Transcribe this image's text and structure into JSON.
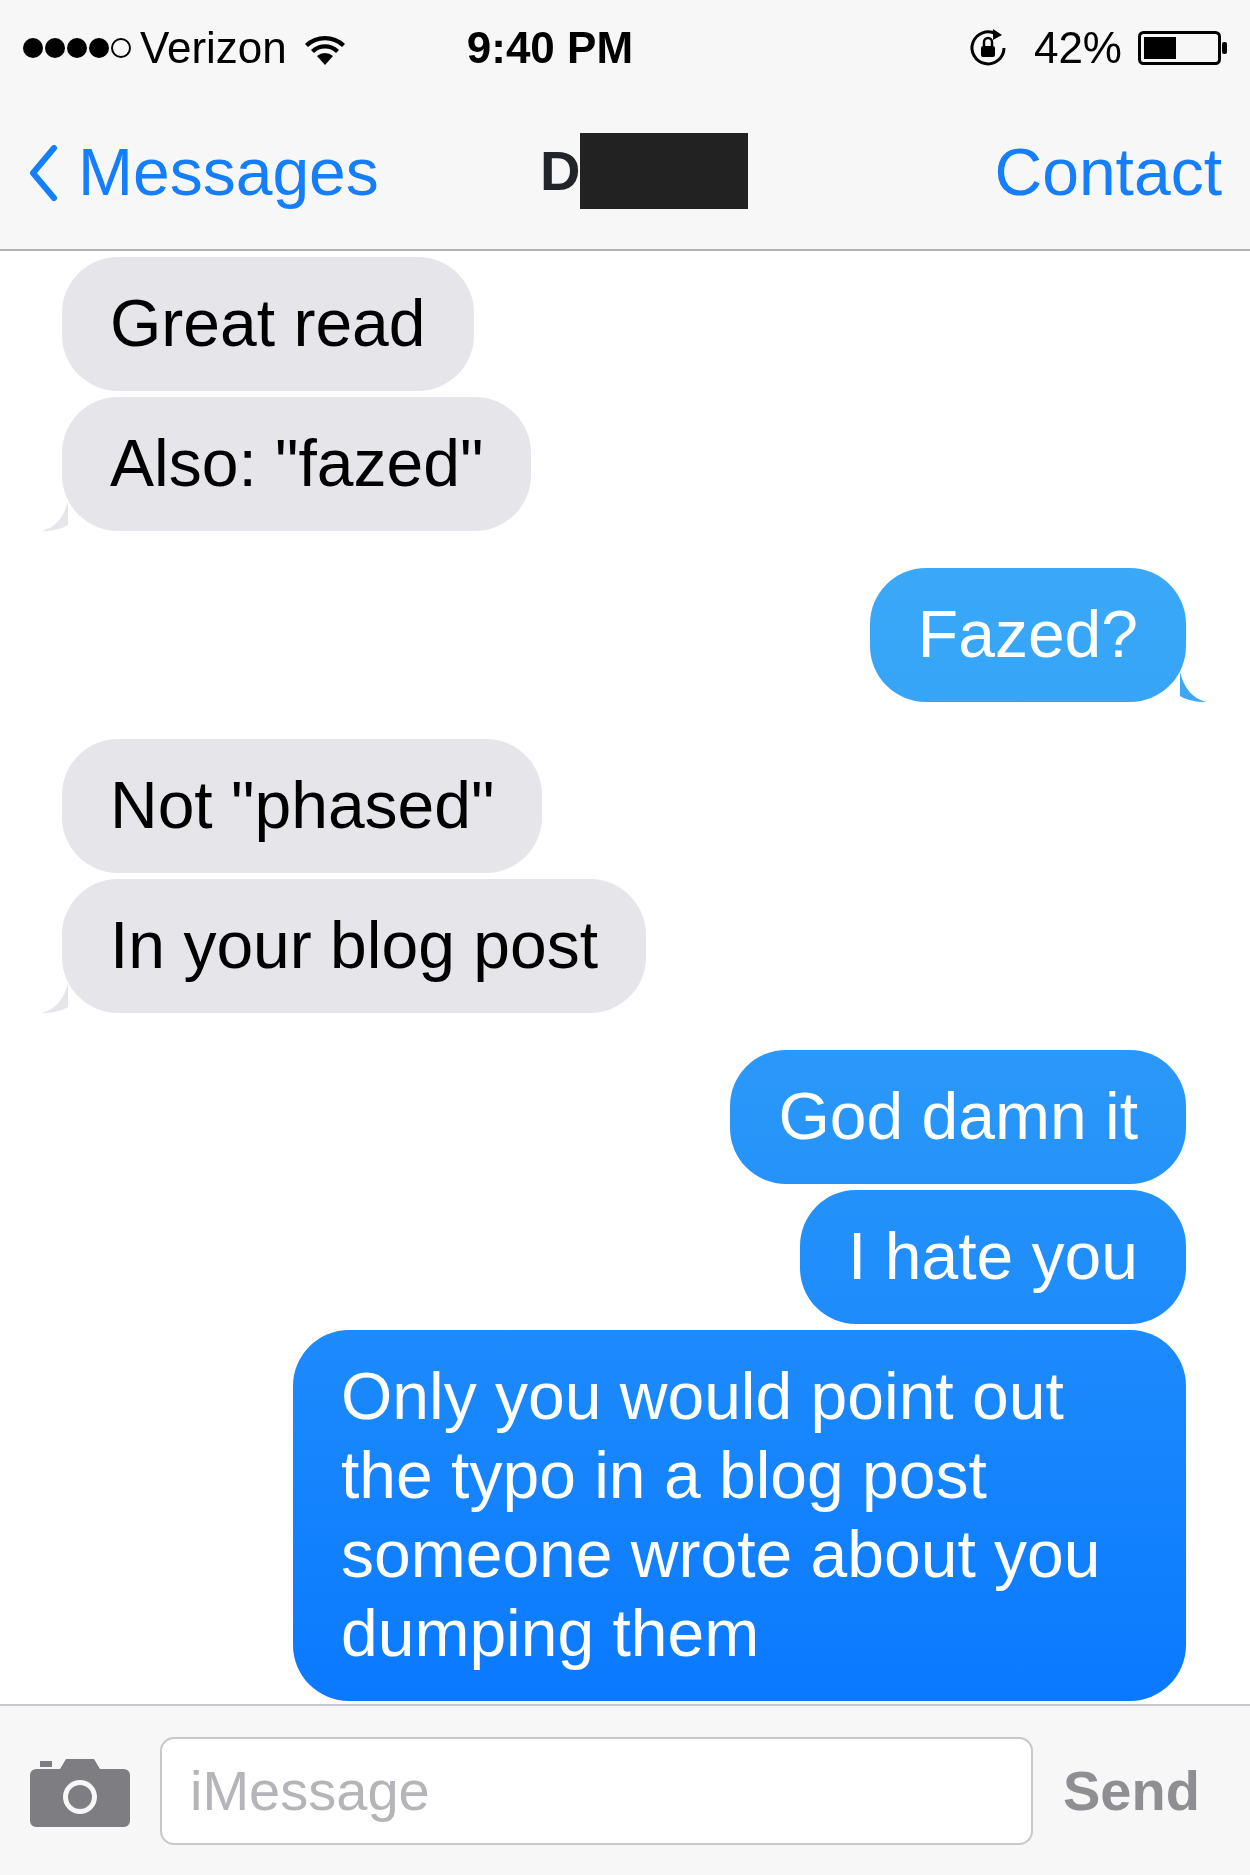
{
  "status_bar": {
    "carrier": "Verizon",
    "time": "9:40 PM",
    "battery": "42%"
  },
  "nav": {
    "back": "Messages",
    "title": "D",
    "title_redacted": true,
    "action": "Contact"
  },
  "messages": [
    {
      "kind": "received",
      "text": "Great read",
      "tail": false
    },
    {
      "kind": "received",
      "text": "Also: \"fazed\"",
      "tail": true
    },
    {
      "kind": "sent",
      "text": "Fazed?",
      "tail": true
    },
    {
      "kind": "received",
      "text": "Not \"phased\"",
      "tail": false
    },
    {
      "kind": "received",
      "text": "In your blog post",
      "tail": true
    },
    {
      "kind": "sent",
      "text": "God damn it",
      "tail": false
    },
    {
      "kind": "sent",
      "text": "I hate you",
      "tail": false
    },
    {
      "kind": "sent",
      "text": "Only you would point out the typo in a blog post someone wrote about you dumping them",
      "tail": false
    }
  ],
  "composer": {
    "placeholder": "iMessage",
    "send": {
      "label": "Send",
      "disabled": true
    }
  }
}
